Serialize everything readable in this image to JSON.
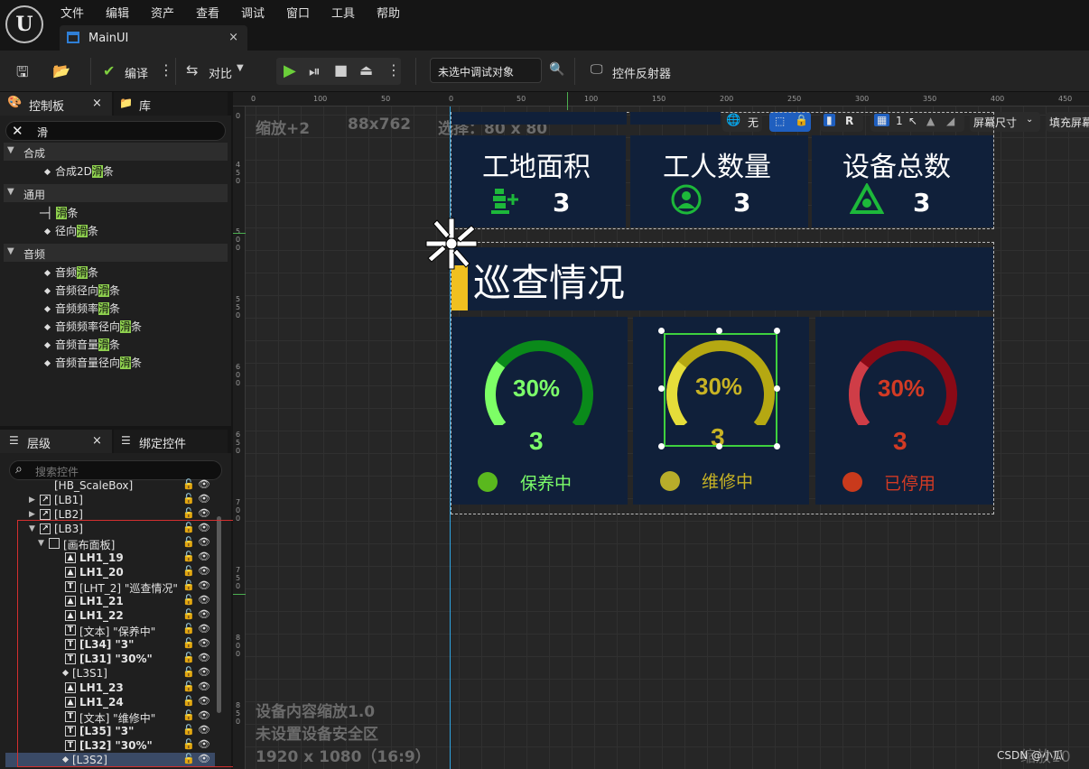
{
  "menu": [
    "文件",
    "编辑",
    "资产",
    "查看",
    "调试",
    "窗口",
    "工具",
    "帮助"
  ],
  "document_tab": {
    "label": "MainUI",
    "close": "×"
  },
  "toolbar": {
    "compile_label": "编译",
    "diff_label": "对比",
    "debug_target": "未选中调试对象",
    "widget_reflector": "控件反射器"
  },
  "palette": {
    "tab_palette": "控制板",
    "tab_library": "库",
    "close": "×",
    "search_value": "滑",
    "categories": [
      {
        "name": "合成",
        "items": [
          {
            "pre": "合成2D",
            "hl": "滑",
            "post": "条"
          }
        ]
      },
      {
        "name": "通用",
        "items": [
          {
            "pre": "",
            "hl": "滑",
            "post": "条"
          },
          {
            "pre": "径向",
            "hl": "滑",
            "post": "条"
          }
        ]
      },
      {
        "name": "音频",
        "items": [
          {
            "pre": "音频",
            "hl": "滑",
            "post": "条"
          },
          {
            "pre": "音频径向",
            "hl": "滑",
            "post": "条"
          },
          {
            "pre": "音频频率",
            "hl": "滑",
            "post": "条"
          },
          {
            "pre": "音频频率径向",
            "hl": "滑",
            "post": "条"
          },
          {
            "pre": "音频音量",
            "hl": "滑",
            "post": "条"
          },
          {
            "pre": "音频音量径向",
            "hl": "滑",
            "post": "条"
          }
        ]
      }
    ]
  },
  "hierarchy": {
    "tab_hierarchy": "层级",
    "tab_bind": "绑定控件",
    "close": "×",
    "search_placeholder": "搜索控件",
    "rows": [
      {
        "label": "[HB_ScaleBox]",
        "icon": "",
        "bold": false
      },
      {
        "label": "[LB1]",
        "icon": "box",
        "bold": false
      },
      {
        "label": "[LB2]",
        "icon": "box",
        "bold": false
      },
      {
        "label": "[LB3]",
        "icon": "box",
        "bold": false
      },
      {
        "label": "[画布面板]",
        "icon": "canvas",
        "bold": false
      },
      {
        "label": "LH1_19",
        "icon": "img",
        "bold": true
      },
      {
        "label": "LH1_20",
        "icon": "img",
        "bold": true
      },
      {
        "label": "[LHT_2] \"巡查情况\"",
        "icon": "T",
        "bold": false
      },
      {
        "label": "LH1_21",
        "icon": "img",
        "bold": true
      },
      {
        "label": "LH1_22",
        "icon": "img",
        "bold": true
      },
      {
        "label": "[文本] \"保养中\"",
        "icon": "T",
        "bold": false
      },
      {
        "label": "[L34] \"3\"",
        "icon": "T",
        "bold": true
      },
      {
        "label": "[L31] \"30%\"",
        "icon": "T",
        "bold": true
      },
      {
        "label": "[L3S1]",
        "icon": "dot",
        "bold": false
      },
      {
        "label": "LH1_23",
        "icon": "img",
        "bold": true
      },
      {
        "label": "LH1_24",
        "icon": "img",
        "bold": true
      },
      {
        "label": "[文本] \"维修中\"",
        "icon": "T",
        "bold": false
      },
      {
        "label": "[L35] \"3\"",
        "icon": "T",
        "bold": true
      },
      {
        "label": "[L32] \"30%\"",
        "icon": "T",
        "bold": true
      },
      {
        "label": "[L3S2]",
        "icon": "dot",
        "bold": false
      }
    ]
  },
  "viewport": {
    "zoom": "缩放+2",
    "size": "88x762",
    "selection": "选择：80 x 80",
    "ruler_top": [
      "0",
      "100",
      "50",
      "0",
      "50",
      "100",
      "150",
      "200",
      "250",
      "300",
      "350",
      "400",
      "450"
    ],
    "ruler_left": [
      "0",
      "4\n5\n0",
      "5\n0\n0",
      "5\n5\n0",
      "6\n0\n0",
      "6\n5\n0",
      "7\n0\n0",
      "7\n5\n0",
      "8\n0\n0",
      "8\n5\n0"
    ],
    "no_label": "无",
    "r_label": "R",
    "one_label": "1",
    "screen_size": "屏幕尺寸",
    "fill_screen": "填充屏幕",
    "device_scale": "设备内容缩放1.0",
    "safe_zone": "未设置设备安全区",
    "resolution": "1920 x 1080（16:9）",
    "watermark_left": "CSDN @小瓜",
    "watermark_right": "缩放10"
  },
  "stats": [
    {
      "title": "工地面积",
      "value": "3",
      "icon": "site-icon"
    },
    {
      "title": "工人数量",
      "value": "3",
      "icon": "worker-icon"
    },
    {
      "title": "设备总数",
      "value": "3",
      "icon": "equipment-icon"
    }
  ],
  "section_title": "巡查情况",
  "gauges": [
    {
      "percent": "30%",
      "level": 0.3,
      "count": "3",
      "label": "保养中",
      "color": "#3fd14a",
      "track": "#0a8a1a",
      "accent": "#7dff66",
      "text": "#7cff6a",
      "dot": "#5ab81e"
    },
    {
      "percent": "30%",
      "level": 0.3,
      "count": "3",
      "label": "维修中",
      "color": "#c8b81a",
      "track": "#b5a812",
      "accent": "#e5dd3a",
      "text": "#c8b324",
      "dot": "#b8ad2a"
    },
    {
      "percent": "30%",
      "level": 0.3,
      "count": "3",
      "label": "已停用",
      "color": "#c0303a",
      "track": "#8a0a16",
      "accent": "#cf3d47",
      "text": "#d23a24",
      "dot": "#c93a1c"
    }
  ]
}
